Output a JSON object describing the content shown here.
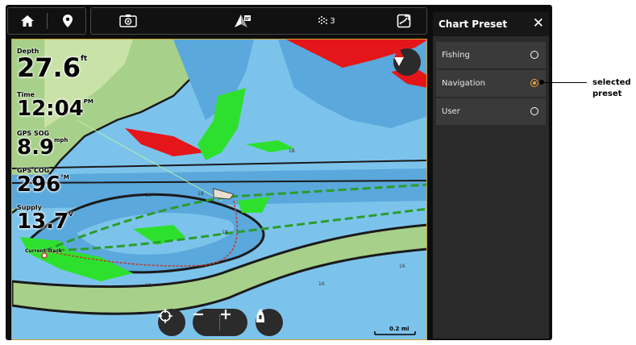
{
  "toolbar": {
    "icons": [
      "home-icon",
      "waypoint-pin-icon",
      "sonar-icon",
      "chart-nav-icon",
      "sensor-satellites-icon",
      "chart-card-icon"
    ],
    "satellite_count": "3"
  },
  "datapoints": [
    {
      "label": "Depth",
      "value": "27.6",
      "unit": "ft"
    },
    {
      "label": "Time",
      "value": "12:04",
      "unit": "PM"
    },
    {
      "label": "GPS SOG",
      "value": "8.9",
      "unit": "mph"
    },
    {
      "label": "GPS COG",
      "value": "296",
      "unit": "°M"
    },
    {
      "label": "Supply",
      "value": "13.7",
      "unit": "V"
    }
  ],
  "map": {
    "track_label": "Current Track",
    "scale_label": "0.2 mi",
    "depth_labels": [
      "18",
      "18",
      "18",
      "18",
      "16",
      "16",
      "18"
    ]
  },
  "chart_preset": {
    "title": "Chart Preset",
    "close_label": "✕",
    "options": [
      {
        "label": "Fishing",
        "selected": false
      },
      {
        "label": "Navigation",
        "selected": true
      },
      {
        "label": "User",
        "selected": false
      }
    ]
  },
  "callout": {
    "line1": "selected",
    "line2": "preset"
  },
  "colors": {
    "accent": "#f0a030",
    "water": "#7cc3ec",
    "land": "#a7d08a",
    "shallow": "#2ee02e",
    "danger": "#e4161a"
  }
}
